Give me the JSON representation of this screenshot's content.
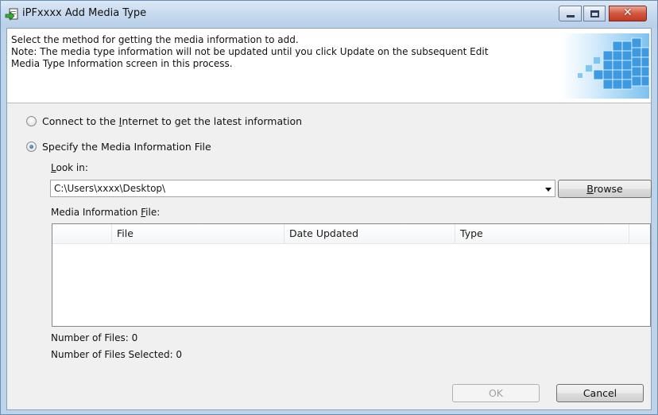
{
  "window": {
    "title": "iPFxxxx Add Media Type",
    "minimize_glyph": "",
    "close_glyph": "✕"
  },
  "header": {
    "line1": "Select the method for getting the media information to add.",
    "line2": "Note: The media type information will not be updated until you click Update on the subsequent Edit",
    "line3": "Media Type Information screen in this process.",
    "art_icon": "media-cube-graphic"
  },
  "options": {
    "internet": {
      "label_pre": "Connect to the ",
      "label_key": "I",
      "label_post": "nternet to get the latest information",
      "checked": false
    },
    "file": {
      "label": "Specify the Media Information File",
      "checked": true
    }
  },
  "look_in": {
    "label_key": "L",
    "label_post": "ook in:",
    "value": "C:\\Users\\xxxx\\Desktop\\"
  },
  "browse_button": {
    "label_key": "B",
    "label_post": "rowse"
  },
  "media_file": {
    "label_pre": "Media Information ",
    "label_key": "F",
    "label_post": "ile:",
    "columns": [
      "",
      "File",
      "Date Updated",
      "Type"
    ],
    "rows": []
  },
  "status": {
    "files": "Number of Files: 0",
    "selected": "Number of Files Selected: 0"
  },
  "footer": {
    "ok_label": "OK",
    "cancel_label": "Cancel"
  },
  "colors": {
    "title_bar": "#c4d8ee",
    "close_button": "#d2573f",
    "dialog_bg": "#f0f0f0",
    "radio_selected": "#1b4f98"
  }
}
